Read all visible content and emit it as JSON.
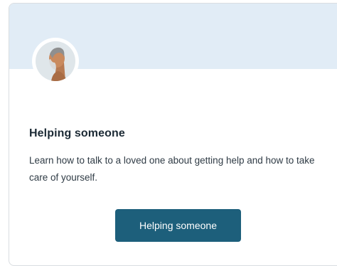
{
  "card": {
    "avatar_icon": "person-profile-illustration",
    "title": "Helping someone",
    "description": "Learn how to talk to a loved one about getting help and how to take care of yourself.",
    "button_label": "Helping someone"
  },
  "colors": {
    "banner": "#e1ecf6",
    "button": "#1d5f7b",
    "title": "#1c2a35"
  }
}
